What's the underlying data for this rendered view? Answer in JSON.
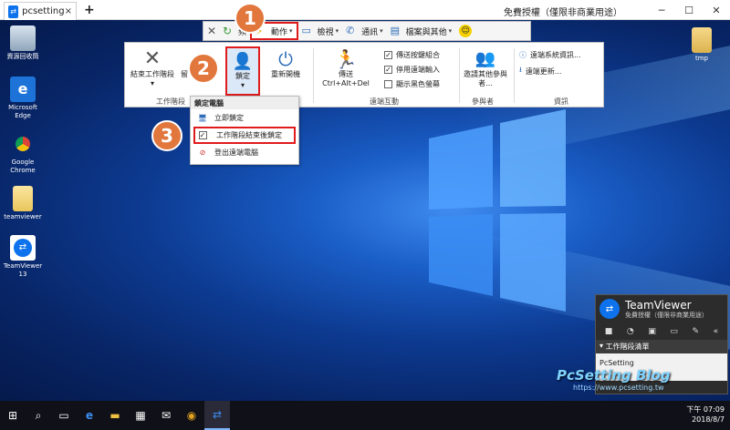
{
  "titlebar": {
    "tab_label": "pcsetting",
    "tab_close": "×",
    "new_tab": "+",
    "title": "免費授權（僅限非商業用途）",
    "minimize": "─",
    "maximize": "☐",
    "close": "✕"
  },
  "toolbar": {
    "items": [
      {
        "label": "頻",
        "icon": "end-session-icon"
      },
      {
        "label": "動作",
        "icon": "lightning-icon"
      },
      {
        "label": "檢視",
        "icon": "monitor-icon"
      },
      {
        "label": "通訊",
        "icon": "chat-icon"
      },
      {
        "label": "檔案與其他",
        "icon": "file-icon"
      }
    ]
  },
  "ribbon": {
    "end_session": "結束工作階段",
    "end_session_caret": "▾",
    "share_label": "留",
    "lock_label": "鎖定",
    "lock_caret": "▾",
    "reboot_label": "重新開機",
    "send_label": "傳送",
    "send_sub": "Ctrl+Alt+Del",
    "check1": "傳送按鍵組合",
    "check2": "停用遠端輸入",
    "check3": "顯示黑色螢幕",
    "invite_label": "邀請其他參與者...",
    "sysinfo": "遠端系統資訊...",
    "update": "遠端更新...",
    "group_session": "工作階段",
    "group_remote": "遠端互動",
    "group_participants": "參與者",
    "group_info": "資訊"
  },
  "dropdown": {
    "header": "鎖定電腦",
    "item1": "立即鎖定",
    "item2": "工作階段結束後鎖定",
    "item3": "登出遠端電腦"
  },
  "badges": [
    "1",
    "2",
    "3"
  ],
  "desktop_icons": [
    {
      "label": "資源回收筒"
    },
    {
      "label": "Microsoft Edge"
    },
    {
      "label": "Google Chrome"
    },
    {
      "label": "teamviewer"
    },
    {
      "label": "TeamViewer 13"
    },
    {
      "label": "tmp"
    }
  ],
  "tv_panel": {
    "name": "TeamViewer",
    "sub": "免費授權（僅限非商業用途）",
    "sessions_header": "工作階段清單",
    "session_name": "PcSetting"
  },
  "watermark": {
    "brand": "PcSetting Blog",
    "url": "https://www.pcsetting.tw"
  },
  "tray": {
    "time": "下午 07:09",
    "date": "2018/8/7"
  },
  "colors": {
    "highlight_red": "#e01b1b",
    "badge_orange": "#e2773d",
    "tv_blue": "#0e72ed"
  }
}
